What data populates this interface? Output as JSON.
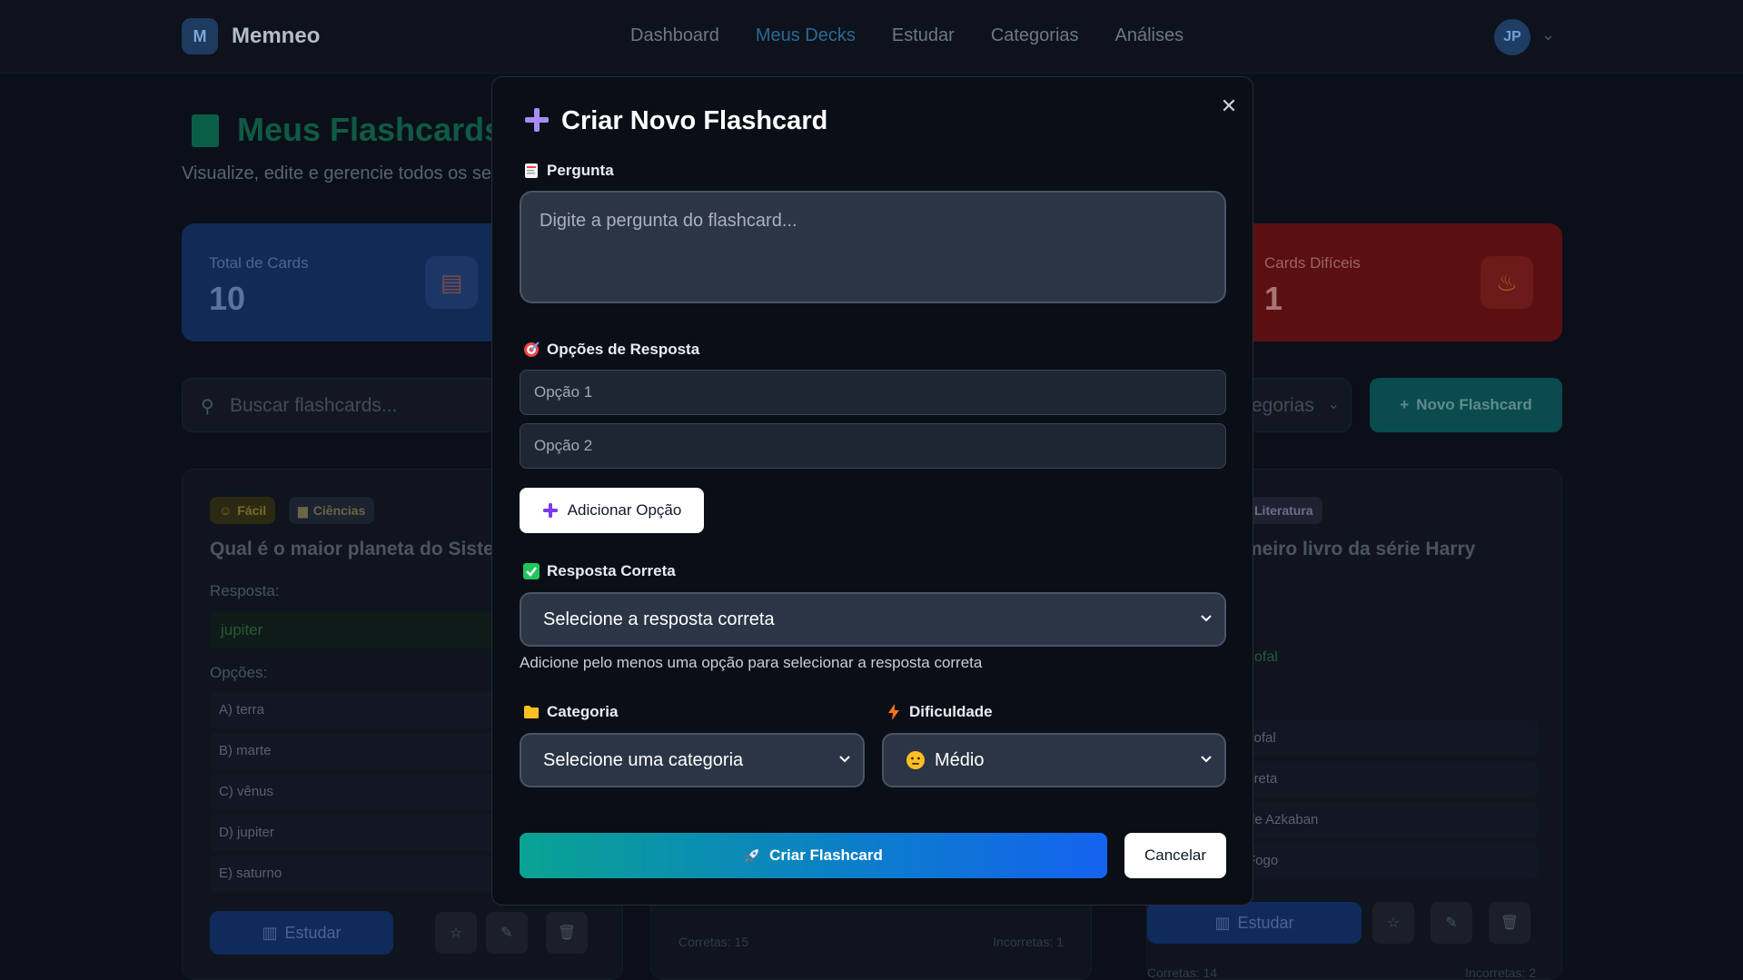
{
  "app": {
    "logo_letter": "M",
    "name": "Memneo"
  },
  "nav": {
    "items": [
      "Dashboard",
      "Meus Decks",
      "Estudar",
      "Categorias",
      "Análises"
    ],
    "active": "Meus Decks",
    "avatar_initials": "JP"
  },
  "page": {
    "title": "Meus Flashcards",
    "subtitle": "Visualize, edite e gerencie todos os se"
  },
  "stats": {
    "total_label": "Total de Cards",
    "total_value": "10",
    "hard_label": "Cards Difíceis",
    "hard_value": "1"
  },
  "toolbar": {
    "search_placeholder": "Buscar flashcards...",
    "category_filter_fragment": "egorias",
    "new_button": "Novo Flashcard"
  },
  "cards": {
    "left": {
      "difficulty": "Fácil",
      "category": "Ciências",
      "question": "Qual é o maior planeta do Sisten",
      "answer_label": "Resposta:",
      "answer": "jupiter",
      "options_label": "Opções:",
      "options": [
        "A) terra",
        "B) marte",
        "C) vênus",
        "D) jupiter",
        "E) saturno"
      ],
      "study_button": "Estudar"
    },
    "middle": {
      "correct": "Corretas: 15",
      "incorrect": "Incorretas: 1"
    },
    "right": {
      "category": "Literatura",
      "question": "meiro livro da série Harry",
      "answer_fragment": "sofal",
      "options_fragments": [
        "sofal",
        "creta",
        "de Azkaban",
        "Fogo"
      ],
      "study_button": "Estudar",
      "correct": "Corretas: 14",
      "incorrect": "Incorretas: 2"
    }
  },
  "modal": {
    "title": "Criar Novo Flashcard",
    "question_label": "Pergunta",
    "question_placeholder": "Digite a pergunta do flashcard...",
    "options_label": "Opções de Resposta",
    "option1_placeholder": "Opção 1",
    "option2_placeholder": "Opção 2",
    "add_option_button": "Adicionar Opção",
    "correct_label": "Resposta Correta",
    "correct_select": "Selecione a resposta correta",
    "correct_help": "Adicione pelo menos uma opção para selecionar a resposta correta",
    "category_label": "Categoria",
    "category_select": "Selecione uma categoria",
    "difficulty_label": "Dificuldade",
    "difficulty_select": "Médio",
    "create_button": "Criar Flashcard",
    "cancel_button": "Cancelar"
  },
  "colors": {
    "accent_gradient_start": "#0aa393",
    "accent_gradient_end": "#1463f0",
    "modal_bg": "#0a0e16",
    "page_bg": "#0b0f19"
  }
}
